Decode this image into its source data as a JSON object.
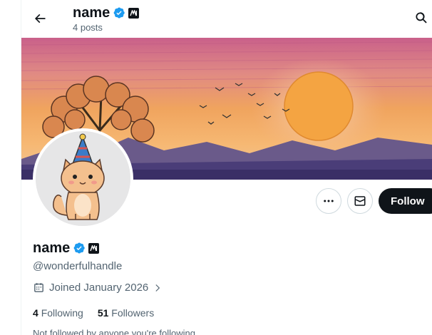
{
  "header": {
    "name": "name",
    "posts": "4 posts"
  },
  "profile": {
    "name": "name",
    "handle": "@wonderfulhandle",
    "joined": "Joined January 2026",
    "following_count": "4",
    "following_label": "Following",
    "followers_count": "51",
    "followers_label": "Followers",
    "followed_note": "Not followed by anyone you're following"
  },
  "actions": {
    "follow_label": "Follow"
  },
  "icons": {
    "back": "arrow-left-icon",
    "search": "search-icon",
    "more": "more-horizontal-icon",
    "message": "envelope-icon",
    "verified": "verified-badge-icon",
    "org": "affiliate-badge-icon",
    "calendar": "calendar-icon",
    "chevron": "chevron-right-icon"
  },
  "colors": {
    "accent": "#1d9bf0",
    "text": "#0f1419",
    "muted": "#536471",
    "follow_bg": "#0f1419"
  }
}
